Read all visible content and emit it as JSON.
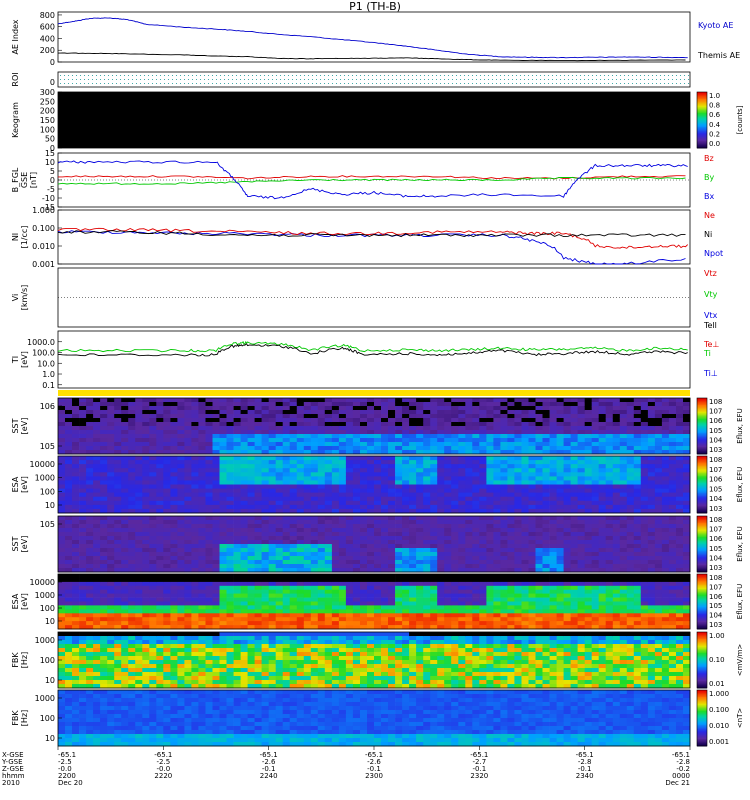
{
  "title": "P1 (TH-B)",
  "colors": {
    "kyoto": "#0000cc",
    "themis": "#000000",
    "bz": "#e00000",
    "by": "#00c800",
    "bx": "#0000e0",
    "ne": "#e00000",
    "ni": "#000000",
    "npot": "#0000e0",
    "vtz": "#e00000",
    "vty": "#00c800",
    "vtx": "#0000e0",
    "teperp": "#e00000",
    "ti": "#00c800",
    "tiperp": "#0000e0",
    "tepar": "#00c800",
    "tipar": "#000000",
    "bar": "#ffe000"
  },
  "chart_data": [
    {
      "type": "line",
      "panel": "ae",
      "ylabel": "AE Index",
      "yticks": [
        "0",
        "200",
        "400",
        "600",
        "800"
      ],
      "ylim": [
        0,
        850
      ],
      "series": [
        {
          "name": "Kyoto AE",
          "x": [
            0,
            3,
            5,
            8,
            11,
            14,
            20,
            25,
            30,
            35,
            40,
            45,
            50,
            55,
            60,
            65,
            70,
            75,
            80,
            85,
            90,
            95,
            100
          ],
          "y": [
            650,
            700,
            740,
            750,
            720,
            640,
            590,
            560,
            520,
            470,
            430,
            380,
            330,
            270,
            200,
            130,
            90,
            80,
            75,
            80,
            85,
            80,
            75
          ]
        },
        {
          "name": "Themis AE",
          "x": [
            0,
            5,
            10,
            20,
            25,
            30,
            35,
            40,
            45,
            50,
            55,
            60,
            65,
            70,
            80,
            90,
            100
          ],
          "y": [
            150,
            150,
            140,
            120,
            100,
            90,
            60,
            55,
            60,
            65,
            70,
            55,
            40,
            30,
            25,
            30,
            35
          ]
        }
      ]
    },
    {
      "type": "heatmap",
      "panel": "roi",
      "ylabel": "ROI",
      "ytick_labels": [
        "0"
      ]
    },
    {
      "type": "heatmap",
      "panel": "keogram",
      "ylabel": "Keogram",
      "yticks": [
        "0",
        "50",
        "100",
        "150",
        "200",
        "250",
        "300"
      ],
      "ylim": [
        0,
        300
      ],
      "colorbar": {
        "label": "[counts]",
        "ticks": [
          "0.0",
          "0.2",
          "0.4",
          "0.6",
          "0.8",
          "1.0"
        ]
      }
    },
    {
      "type": "line",
      "panel": "bfgl",
      "ylabel": "B_FGL",
      "ylabel2": "GSE",
      "ylabel3": "[nT]",
      "yticks": [
        "15",
        "10",
        "5",
        "0",
        "-5",
        "-10",
        "-15"
      ],
      "ylim": [
        -15,
        15
      ],
      "series": [
        {
          "name": "Bz",
          "x": [
            0,
            10,
            20,
            30,
            40,
            50,
            60,
            70,
            80,
            90,
            100
          ],
          "y": [
            2,
            2,
            2,
            1,
            2,
            2,
            2,
            1,
            1,
            2,
            2
          ]
        },
        {
          "name": "By",
          "x": [
            0,
            10,
            20,
            30,
            40,
            50,
            60,
            70,
            80,
            90,
            100
          ],
          "y": [
            -2,
            -2,
            -2,
            -1,
            0,
            0,
            0,
            0,
            1,
            1,
            1
          ]
        },
        {
          "name": "Bx",
          "x": [
            0,
            5,
            15,
            25,
            28,
            30,
            35,
            40,
            45,
            50,
            55,
            60,
            70,
            80,
            82,
            85,
            90,
            95,
            100
          ],
          "y": [
            10,
            10,
            10,
            10,
            0,
            -9,
            -10,
            -5,
            -8,
            -7,
            -9,
            -9,
            -8,
            -9,
            0,
            8,
            8,
            8,
            8
          ]
        }
      ]
    },
    {
      "type": "line",
      "panel": "ni",
      "ylabel": "NI",
      "ylabel2": "[1/cc]",
      "yticks": [
        "1.000",
        "0.100",
        "0.010",
        "0.001"
      ],
      "ylim": [
        0.001,
        1
      ],
      "yscale": "log",
      "series": [
        {
          "name": "Ne",
          "x": [
            0,
            10,
            20,
            30,
            40,
            50,
            60,
            70,
            75,
            80,
            85,
            90,
            95,
            100
          ],
          "y": [
            0.08,
            0.08,
            0.07,
            0.06,
            0.05,
            0.05,
            0.06,
            0.06,
            0.05,
            0.05,
            0.01,
            0.008,
            0.01,
            0.01
          ]
        },
        {
          "name": "Ni",
          "x": [
            0,
            10,
            20,
            30,
            40,
            50,
            60,
            70,
            80,
            90,
            100
          ],
          "y": [
            0.06,
            0.06,
            0.05,
            0.04,
            0.04,
            0.04,
            0.04,
            0.04,
            0.04,
            0.04,
            0.04
          ]
        },
        {
          "name": "Npot",
          "x": [
            0,
            10,
            20,
            30,
            40,
            50,
            60,
            70,
            75,
            80,
            85,
            90,
            100
          ],
          "y": [
            0.06,
            0.06,
            0.05,
            0.05,
            0.04,
            0.04,
            0.04,
            0.04,
            0.02,
            0.002,
            0.001,
            0.001,
            0.002
          ]
        }
      ]
    },
    {
      "type": "line",
      "panel": "vi",
      "ylabel": "Vi",
      "ylabel2": "[km/s]",
      "series": [
        {
          "name": "Vtz",
          "y": []
        },
        {
          "name": "Vty",
          "y": []
        },
        {
          "name": "Vtx",
          "y": []
        }
      ]
    },
    {
      "type": "line",
      "panel": "ti",
      "ylabel": "TI",
      "ylabel2": "[eV]",
      "yticks": [
        "1000.0",
        "100.0",
        "10.0",
        "1.0",
        "0.1"
      ],
      "ylim": [
        0.05,
        10000
      ],
      "yscale": "log",
      "series": [
        {
          "name": "Tell",
          "x": [
            0,
            10,
            20,
            25,
            28,
            30,
            35,
            40,
            45,
            48,
            55,
            60,
            65,
            70,
            75,
            80,
            85,
            90,
            95,
            100
          ],
          "y": [
            150,
            150,
            150,
            150,
            700,
            800,
            600,
            150,
            450,
            150,
            180,
            150,
            180,
            250,
            180,
            200,
            250,
            150,
            250,
            200
          ]
        },
        {
          "name": "Te⊥",
          "x": [
            0,
            10,
            20,
            25,
            28,
            30,
            35,
            40,
            45,
            48,
            55,
            60,
            65,
            70,
            75,
            80,
            85,
            90,
            95,
            100
          ],
          "y": [
            60,
            60,
            60,
            60,
            400,
            500,
            400,
            60,
            250,
            60,
            80,
            60,
            80,
            150,
            60,
            80,
            120,
            70,
            120,
            80
          ]
        },
        {
          "name": "Ti"
        },
        {
          "name": "Ti⊥"
        }
      ]
    },
    {
      "type": "heatmap",
      "panel": "sst-i",
      "ylabel": "SST",
      "ylabel2": "[eV]",
      "ytick_labels": [
        "10^6",
        "10^5"
      ],
      "colorbar": {
        "label": "Eflux, EFU",
        "ticks": [
          "10^8",
          "10^7",
          "10^6",
          "10^5",
          "10^4",
          "10^3"
        ]
      }
    },
    {
      "type": "heatmap",
      "panel": "esa-i",
      "ylabel": "ESA",
      "ylabel2": "[eV]",
      "ytick_labels": [
        "10000",
        "1000",
        "100",
        "10"
      ],
      "colorbar": {
        "label": "Eflux, EFU",
        "ticks": [
          "10^8",
          "10^7",
          "10^6",
          "10^5",
          "10^4",
          "10^3"
        ]
      }
    },
    {
      "type": "heatmap",
      "panel": "sst-e",
      "ylabel": "SST",
      "ylabel2": "[eV]",
      "ytick_labels": [
        "10^5"
      ],
      "colorbar": {
        "label": "Eflux, EFU",
        "ticks": [
          "10^8",
          "10^7",
          "10^6",
          "10^5",
          "10^4",
          "10^3"
        ]
      }
    },
    {
      "type": "heatmap",
      "panel": "esa-e",
      "ylabel": "ESA",
      "ylabel2": "[eV]",
      "ytick_labels": [
        "10000",
        "1000",
        "100",
        "10"
      ],
      "colorbar": {
        "label": "Eflux, EFU",
        "ticks": [
          "10^8",
          "10^7",
          "10^6",
          "10^5",
          "10^4",
          "10^3"
        ]
      }
    },
    {
      "type": "heatmap",
      "panel": "fbk-e",
      "ylabel": "FBK",
      "ylabel2": "[Hz]",
      "ytick_labels": [
        "1000",
        "100",
        "10"
      ],
      "colorbar": {
        "label": "<mV/m>",
        "ticks": [
          "1.00",
          "0.10",
          "0.01"
        ]
      }
    },
    {
      "type": "heatmap",
      "panel": "fbk-b",
      "ylabel": "FBK",
      "ylabel2": "[Hz]",
      "ytick_labels": [
        "1000",
        "100",
        "10"
      ],
      "colorbar": {
        "label": "<nT>",
        "ticks": [
          "1.000",
          "0.100",
          "0.010",
          "0.001"
        ]
      }
    }
  ],
  "xaxis": {
    "row_labels": [
      "X-GSE",
      "Y-GSE",
      "Z-GSE",
      "hhmm",
      "2010"
    ],
    "ticks": [
      {
        "vals": [
          "-65.1",
          "-2.5",
          "-0.0",
          "2200",
          "Dec 20"
        ]
      },
      {
        "vals": [
          "-65.1",
          "-2.5",
          "-0.0",
          "2220",
          ""
        ]
      },
      {
        "vals": [
          "-65.1",
          "-2.6",
          "-0.1",
          "2240",
          ""
        ]
      },
      {
        "vals": [
          "-65.1",
          "-2.6",
          "-0.1",
          "2300",
          ""
        ]
      },
      {
        "vals": [
          "-65.1",
          "-2.7",
          "-0.1",
          "2320",
          ""
        ]
      },
      {
        "vals": [
          "-65.1",
          "-2.8",
          "-0.1",
          "2340",
          ""
        ]
      },
      {
        "vals": [
          "-65.1",
          "-2.8",
          "-0.2",
          "0000",
          "Dec 21"
        ]
      }
    ]
  }
}
